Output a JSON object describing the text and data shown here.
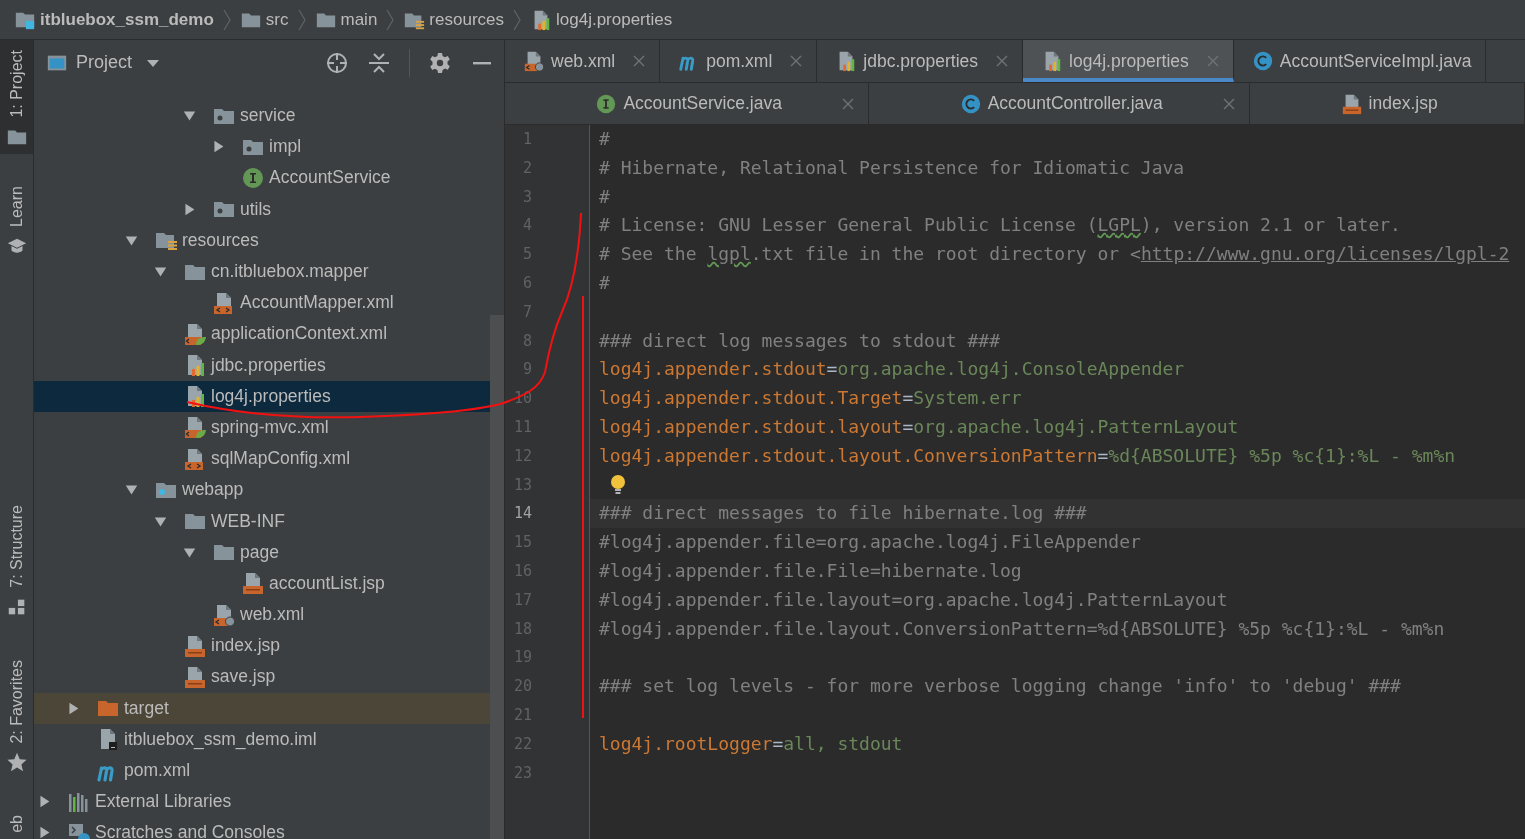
{
  "breadcrumb": [
    {
      "label": "itbluebox_ssm_demo",
      "kind": "project"
    },
    {
      "label": "src",
      "kind": "folder"
    },
    {
      "label": "main",
      "kind": "folder"
    },
    {
      "label": "resources",
      "kind": "resources-folder"
    },
    {
      "label": "log4j.properties",
      "kind": "properties"
    }
  ],
  "tool_windows": [
    {
      "label": "1: Project",
      "kind": "folder",
      "selected": true
    },
    {
      "label": "Learn",
      "kind": "learn",
      "selected": false
    },
    {
      "label": "7: Structure",
      "kind": "structure",
      "selected": false
    },
    {
      "label": "2: Favorites",
      "kind": "star",
      "selected": false
    },
    {
      "label": "eb",
      "selected": false
    }
  ],
  "project_panel": {
    "title": "Project",
    "tree": [
      {
        "children": [
          {
            "children": [
              {
                "children": [
                  {
                    "children": [
                      {
                        "children": [
                          {
                            "label": "service",
                            "kind": "package",
                            "expanded": true,
                            "selected": false,
                            "children": [
                              {
                                "label": "impl",
                                "kind": "package",
                                "expanded": false,
                                "selected": false
                              },
                              {
                                "label": "AccountService",
                                "kind": "interface",
                                "selected": false
                              }
                            ]
                          },
                          {
                            "label": "utils",
                            "kind": "package",
                            "expanded": false,
                            "selected": false
                          }
                        ]
                      }
                    ]
                  },
                  {
                    "label": "resources",
                    "kind": "resources-folder",
                    "expanded": true,
                    "selected": false,
                    "children": [
                      {
                        "label": "cn.itbluebox.mapper",
                        "kind": "folder",
                        "expanded": true,
                        "selected": false,
                        "children": [
                          {
                            "label": "AccountMapper.xml",
                            "kind": "xml",
                            "selected": false
                          }
                        ]
                      },
                      {
                        "label": "applicationContext.xml",
                        "kind": "spring-xml",
                        "selected": false
                      },
                      {
                        "label": "jdbc.properties",
                        "kind": "properties",
                        "selected": false
                      },
                      {
                        "label": "log4j.properties",
                        "kind": "properties",
                        "selected": true
                      },
                      {
                        "label": "spring-mvc.xml",
                        "kind": "spring-xml",
                        "selected": false
                      },
                      {
                        "label": "sqlMapConfig.xml",
                        "kind": "xml",
                        "selected": false
                      }
                    ]
                  },
                  {
                    "label": "webapp",
                    "kind": "web-folder",
                    "expanded": true,
                    "selected": false,
                    "children": [
                      {
                        "label": "WEB-INF",
                        "kind": "folder",
                        "expanded": true,
                        "selected": false,
                        "children": [
                          {
                            "label": "page",
                            "kind": "folder",
                            "expanded": true,
                            "selected": false,
                            "children": [
                              {
                                "label": "accountList.jsp",
                                "kind": "jsp",
                                "selected": false
                              }
                            ]
                          },
                          {
                            "label": "web.xml",
                            "kind": "web-xml",
                            "selected": false
                          }
                        ]
                      },
                      {
                        "label": "index.jsp",
                        "kind": "jsp",
                        "selected": false
                      },
                      {
                        "label": "save.jsp",
                        "kind": "jsp",
                        "selected": false
                      }
                    ]
                  }
                ]
              }
            ]
          },
          {
            "label": "target",
            "kind": "excluded-folder",
            "expanded": false,
            "selected": false
          },
          {
            "label": "itbluebox_ssm_demo.iml",
            "kind": "iml",
            "selected": false
          },
          {
            "label": "pom.xml",
            "kind": "maven",
            "selected": false
          }
        ]
      },
      {
        "label": "External Libraries",
        "kind": "libraries",
        "expanded": false,
        "selected": false
      },
      {
        "label": "Scratches and Consoles",
        "kind": "scratches",
        "expanded": false,
        "selected": false
      }
    ]
  },
  "tab_rows": [
    {
      "tabs": [
        {
          "label": "web.xml",
          "kind": "web-xml",
          "selected": false,
          "closable": true
        },
        {
          "label": "pom.xml",
          "kind": "maven",
          "selected": false,
          "closable": true
        },
        {
          "label": "jdbc.properties",
          "kind": "properties",
          "selected": false,
          "closable": true
        },
        {
          "label": "log4j.properties",
          "kind": "properties",
          "selected": true,
          "closable": true
        },
        {
          "label": "AccountServiceImpl.java",
          "kind": "class",
          "selected": false,
          "closable": false
        }
      ]
    },
    {
      "tabs": [
        {
          "label": "AccountService.java",
          "kind": "interface",
          "selected": false,
          "closable": true
        },
        {
          "label": "AccountController.java",
          "kind": "class",
          "selected": false,
          "closable": true
        },
        {
          "label": "index.jsp",
          "kind": "jsp",
          "selected": false,
          "closable": false
        }
      ]
    }
  ],
  "editor": {
    "lines": [
      {
        "number": "1",
        "current": false,
        "hint": false,
        "tokens": [
          {
            "kind": "comment",
            "text": "#"
          }
        ]
      },
      {
        "number": "2",
        "current": false,
        "hint": false,
        "tokens": [
          {
            "kind": "comment",
            "text": "# Hibernate, Relational Persistence for Idiomatic Java"
          }
        ]
      },
      {
        "number": "3",
        "current": false,
        "hint": false,
        "tokens": [
          {
            "kind": "comment",
            "text": "#"
          }
        ]
      },
      {
        "number": "4",
        "current": false,
        "hint": false,
        "tokens": [
          {
            "kind": "comment",
            "text": "# License: GNU Lesser General Public License ("
          },
          {
            "kind": "typo",
            "text": "LGPL"
          },
          {
            "kind": "comment",
            "text": "), version 2.1 or later."
          }
        ]
      },
      {
        "number": "5",
        "current": false,
        "hint": false,
        "tokens": [
          {
            "kind": "comment",
            "text": "# See the "
          },
          {
            "kind": "typo",
            "text": "lgpl"
          },
          {
            "kind": "comment",
            "text": ".txt file in the root directory or <"
          },
          {
            "kind": "link",
            "text": "http://www.gnu.org/licenses/lgpl-2"
          }
        ]
      },
      {
        "number": "6",
        "current": false,
        "hint": false,
        "tokens": [
          {
            "kind": "comment",
            "text": "#"
          }
        ]
      },
      {
        "number": "7",
        "current": false,
        "hint": false
      },
      {
        "number": "8",
        "current": false,
        "hint": false,
        "tokens": [
          {
            "kind": "comment",
            "text": "### direct log messages to stdout ###"
          }
        ]
      },
      {
        "number": "9",
        "current": false,
        "hint": false,
        "tokens": [
          {
            "kind": "key",
            "text": "log4j.appender.stdout"
          },
          {
            "kind": "op",
            "text": "="
          },
          {
            "kind": "value",
            "text": "org.apache.log4j.ConsoleAppender"
          }
        ]
      },
      {
        "number": "10",
        "current": false,
        "hint": false,
        "tokens": [
          {
            "kind": "key",
            "text": "log4j.appender.stdout.Target"
          },
          {
            "kind": "op",
            "text": "="
          },
          {
            "kind": "value",
            "text": "System.err"
          }
        ]
      },
      {
        "number": "11",
        "current": false,
        "hint": false,
        "tokens": [
          {
            "kind": "key",
            "text": "log4j.appender.stdout.layout"
          },
          {
            "kind": "op",
            "text": "="
          },
          {
            "kind": "value",
            "text": "org.apache.log4j.PatternLayout"
          }
        ]
      },
      {
        "number": "12",
        "current": false,
        "hint": false,
        "tokens": [
          {
            "kind": "key",
            "text": "log4j.appender.stdout.layout.ConversionPattern"
          },
          {
            "kind": "op",
            "text": "="
          },
          {
            "kind": "value",
            "text": "%d{ABSOLUTE} %5p %c{1}:%L - %m%n"
          }
        ]
      },
      {
        "number": "13",
        "current": false,
        "hint": true
      },
      {
        "number": "14",
        "current": true,
        "hint": false,
        "tokens": [
          {
            "kind": "comment",
            "text": "### direct messages to file hibernate.log ###"
          }
        ]
      },
      {
        "number": "15",
        "current": false,
        "hint": false,
        "tokens": [
          {
            "kind": "comment",
            "text": "#log4j.appender.file=org.apache.log4j.FileAppender"
          }
        ]
      },
      {
        "number": "16",
        "current": false,
        "hint": false,
        "tokens": [
          {
            "kind": "comment",
            "text": "#log4j.appender.file.File=hibernate.log"
          }
        ]
      },
      {
        "number": "17",
        "current": false,
        "hint": false,
        "tokens": [
          {
            "kind": "comment",
            "text": "#log4j.appender.file.layout=org.apache.log4j.PatternLayout"
          }
        ]
      },
      {
        "number": "18",
        "current": false,
        "hint": false,
        "tokens": [
          {
            "kind": "comment",
            "text": "#log4j.appender.file.layout.ConversionPattern=%d{ABSOLUTE} %5p %c{1}:%L - %m%n"
          }
        ]
      },
      {
        "number": "19",
        "current": false,
        "hint": false
      },
      {
        "number": "20",
        "current": false,
        "hint": false,
        "tokens": [
          {
            "kind": "comment",
            "text": "### set log levels - for more verbose logging change 'info' to 'debug' ###"
          }
        ]
      },
      {
        "number": "21",
        "current": false,
        "hint": false
      },
      {
        "number": "22",
        "current": false,
        "hint": false,
        "tokens": [
          {
            "kind": "key",
            "text": "log4j.rootLogger"
          },
          {
            "kind": "op",
            "text": "="
          },
          {
            "kind": "value",
            "text": "all, stdout"
          }
        ]
      },
      {
        "number": "23",
        "current": false,
        "hint": false
      }
    ]
  },
  "annotation": {
    "kind": "freehand"
  }
}
